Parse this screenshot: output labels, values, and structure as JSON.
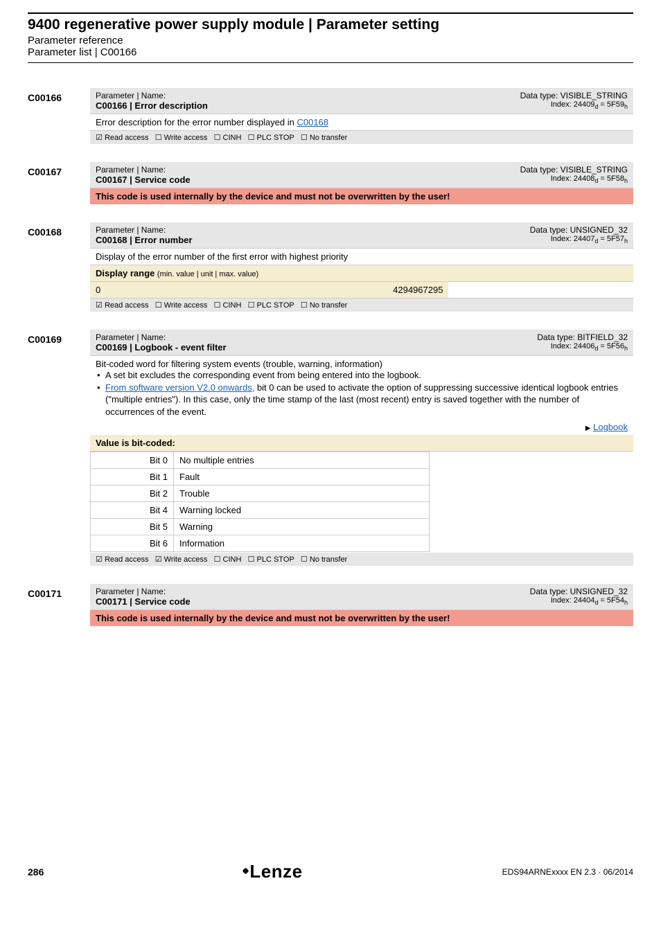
{
  "header": {
    "title": "9400 regenerative power supply module | Parameter setting",
    "subtitle": "Parameter reference",
    "subtitle2": "Parameter list | C00166"
  },
  "flag_labels": {
    "read": "Read access",
    "write": "Write access",
    "cinh": "CINH",
    "plcstop": "PLC STOP",
    "notransfer": "No transfer"
  },
  "entries": [
    {
      "code": "C00166",
      "param_label": "Parameter | Name:",
      "param_name": "C00166 | Error description",
      "data_type": "Data type: VISIBLE_STRING",
      "index_pre": "Index: 24409",
      "index_sub1": "d",
      "index_mid": " = 5F59",
      "index_sub2": "h",
      "desc_pre": "Error description for the error number displayed in ",
      "desc_link": "C00168",
      "flags": {
        "read": true,
        "write": false,
        "cinh": false,
        "plcstop": false,
        "notransfer": false
      }
    },
    {
      "code": "C00167",
      "param_label": "Parameter | Name:",
      "param_name": "C00167 | Service code",
      "data_type": "Data type: VISIBLE_STRING",
      "index_pre": "Index: 24408",
      "index_sub1": "d",
      "index_mid": " = 5F58",
      "index_sub2": "h",
      "warning": "This code is used internally by the device and must not be overwritten by the user!"
    },
    {
      "code": "C00168",
      "param_label": "Parameter | Name:",
      "param_name": "C00168 | Error number",
      "data_type": "Data type: UNSIGNED_32",
      "index_pre": "Index: 24407",
      "index_sub1": "d",
      "index_mid": " = 5F57",
      "index_sub2": "h",
      "desc_plain": "Display of the error number of the first error with highest priority",
      "range_label": "Display range ",
      "range_sub": "(min. value | unit | max. value)",
      "range_min": "0",
      "range_max": "4294967295",
      "flags": {
        "read": true,
        "write": false,
        "cinh": false,
        "plcstop": false,
        "notransfer": false
      }
    },
    {
      "code": "C00169",
      "param_label": "Parameter | Name:",
      "param_name": "C00169 | Logbook - event filter",
      "data_type": "Data type: BITFIELD_32",
      "index_pre": "Index: 24406",
      "index_sub1": "d",
      "index_mid": " = 5F56",
      "index_sub2": "h",
      "desc_plain": "Bit-coded word for filtering system events (trouble, warning, information)",
      "bullets": [
        {
          "pre": "A set bit excludes the corresponding event from being entered into the logbook."
        },
        {
          "link": "From software version V2.0 onwards,",
          "post": " bit 0 can be used to activate the option of suppressing successive identical logbook entries (\"multiple entries\"). In this case, only the time stamp of the last (most recent) entry is saved together with the number of occurrences of the event."
        }
      ],
      "logbook_link": "Logbook",
      "bits_label": "Value is bit-coded:",
      "bits": [
        {
          "n": "Bit 0",
          "v": "No multiple entries"
        },
        {
          "n": "Bit 1",
          "v": "Fault"
        },
        {
          "n": "Bit 2",
          "v": "Trouble"
        },
        {
          "n": "Bit 4",
          "v": "Warning locked"
        },
        {
          "n": "Bit 5",
          "v": "Warning"
        },
        {
          "n": "Bit 6",
          "v": "Information"
        }
      ],
      "flags": {
        "read": true,
        "write": true,
        "cinh": false,
        "plcstop": false,
        "notransfer": false
      }
    },
    {
      "code": "C00171",
      "param_label": "Parameter | Name:",
      "param_name": "C00171 | Service code",
      "data_type": "Data type: UNSIGNED_32",
      "index_pre": "Index: 24404",
      "index_sub1": "d",
      "index_mid": " = 5F54",
      "index_sub2": "h",
      "warning": "This code is used internally by the device and must not be overwritten by the user!"
    }
  ],
  "footer": {
    "page": "286",
    "brand": "Lenze",
    "docid": "EDS94ARNExxxx EN 2.3 · 06/2014"
  }
}
